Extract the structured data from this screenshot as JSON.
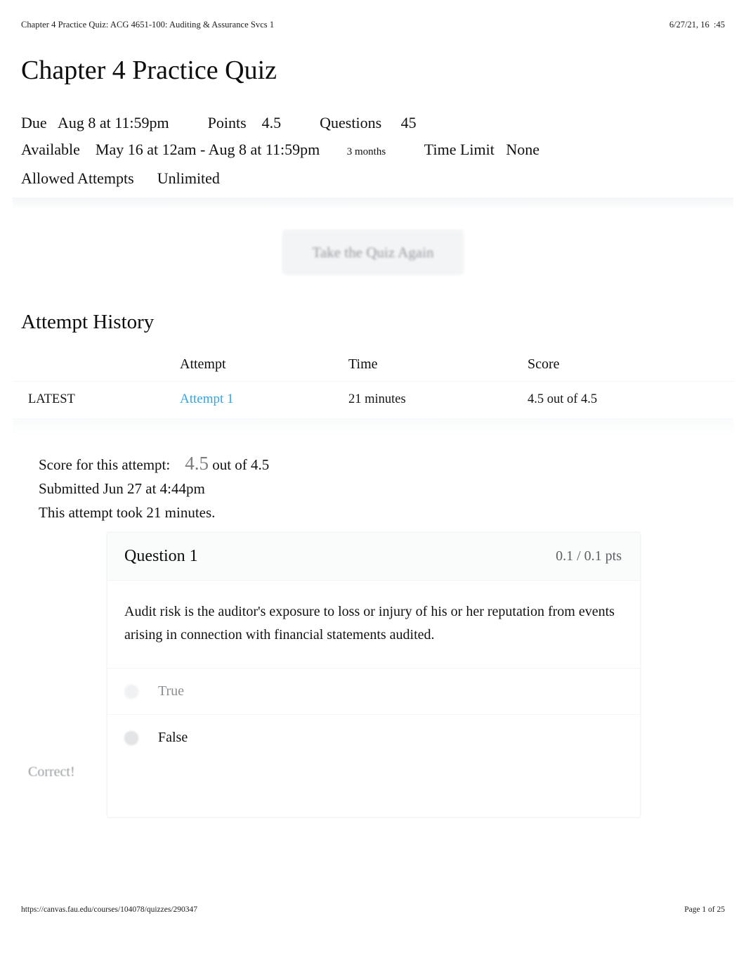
{
  "print_header": {
    "left": "Chapter 4 Practice Quiz: ACG 4651-100: Auditing & Assurance Svcs 1",
    "right": "6/27/21, 16  :45"
  },
  "print_footer": {
    "url": "https://canvas.fau.edu/courses/104078/quizzes/290347",
    "page": "Page 1 of 25"
  },
  "page_title": "Chapter 4 Practice Quiz",
  "quiz_meta": {
    "line1": "Due   Aug 8 at 11:59pm          Points    4.5          Questions     45",
    "line2_a": "Available    May 16 at 12am - Aug 8 at 11:59pm       ",
    "line2_small": "3 months",
    "line2_b": "          Time Limit   None",
    "line3": "Allowed Attempts      Unlimited"
  },
  "retake_button": {
    "label": "Take the Quiz Again"
  },
  "attempt_history": {
    "title": "Attempt History",
    "columns": [
      "",
      "Attempt",
      "Time",
      "Score"
    ],
    "rows": [
      {
        "flag": "LATEST",
        "attempt": "Attempt 1",
        "time": "21 minutes",
        "score": "4.5 out of 4.5"
      }
    ]
  },
  "score_summary": {
    "score_label": "Score for this attempt:",
    "score_value": "4.5",
    "score_out_of": "out of 4.5",
    "submitted": "Submitted Jun 27 at 4:44pm",
    "duration": "This attempt took 21 minutes."
  },
  "question": {
    "title": "Question 1",
    "points": "0.1 / 0.1 pts",
    "text": "Audit risk is the auditor's exposure to loss or injury of his or her reputation from events arising in connection with financial statements audited.",
    "correct_flag": "Correct!",
    "answers": [
      {
        "label": "True",
        "selected": false
      },
      {
        "label": "False",
        "selected": true
      }
    ]
  },
  "colors": {
    "link": "#2fa8e4",
    "text": "#121212",
    "muted": "#8c8f92",
    "card_header_bg": "#fafbfb"
  }
}
